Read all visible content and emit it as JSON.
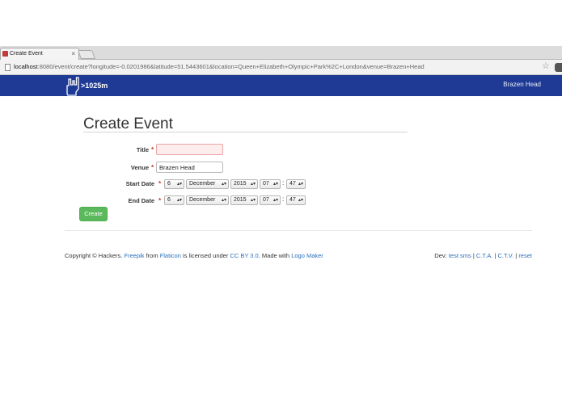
{
  "browser": {
    "tab_title": "Create Event",
    "tab_close": "×",
    "url_host": "localhost",
    "url_rest": ":8080/event/create?longitude=-0.0201986&latitude=51.5443601&location=Queen+Elizabeth+Olympic+Park%2C+London&venue=Brazen+Head"
  },
  "navbar": {
    "logo_text": ">1025m",
    "right_text": "Brazen Head",
    "color": "#1f3a94"
  },
  "form": {
    "title": "Create Event",
    "required_mark": "*",
    "title_label": "Title",
    "title_value": "",
    "venue_label": "Venue",
    "venue_value": "Brazen Head",
    "start_label": "Start Date",
    "end_label": "End Date",
    "start": {
      "day": "6",
      "month": "December",
      "year": "2015",
      "hour": "07",
      "minute": "47"
    },
    "end": {
      "day": "6",
      "month": "December",
      "year": "2015",
      "hour": "07",
      "minute": "47"
    },
    "time_separator": ":",
    "select_arrows": "▴▾",
    "create_button": "Create",
    "create_color": "#5cb85c"
  },
  "footer": {
    "copyright": "Copyright © Hackers.",
    "freepik": "Freepik",
    "from": "from",
    "flaticon": "Flaticon",
    "licensed": "is licensed under",
    "ccby": "CC BY 3.0",
    "made_with": ". Made with",
    "logo_maker": "Logo Maker",
    "dev_label": "Dev:",
    "test_sms": "test sms",
    "cta": "C.T.A.",
    "ctv": "C.T.V.",
    "reset": "reset",
    "sep": "|",
    "link_color": "#2a6ebb"
  }
}
